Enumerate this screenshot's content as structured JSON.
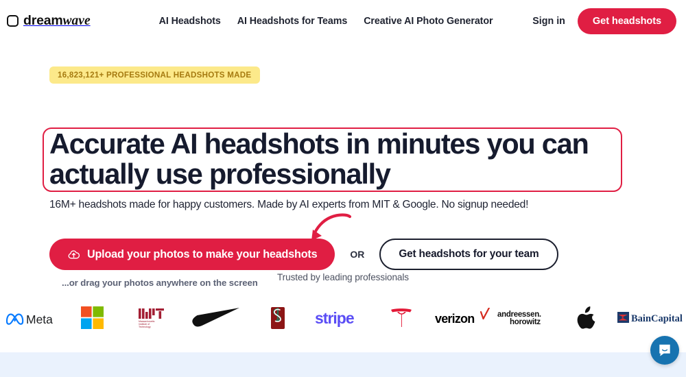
{
  "brand": {
    "name_bold": "dream",
    "name_italic": "wave",
    "mark_icon": "rounded-square-outline-icon"
  },
  "nav": {
    "links": [
      {
        "label": "AI Headshots"
      },
      {
        "label": "AI Headshots for Teams"
      },
      {
        "label": "Creative AI Photo Generator"
      }
    ],
    "sign_in": "Sign in",
    "cta": "Get headshots"
  },
  "hero": {
    "badge": "16,823,121+ PROFESSIONAL HEADSHOTS MADE",
    "headline": "Accurate AI headshots in minutes you can actually use professionally",
    "subhead": "16M+ headshots made for happy customers. Made by AI experts from MIT & Google. No signup needed!",
    "upload_button": "Upload your photos to make your headshots",
    "upload_icon": "cloud-upload-icon",
    "or": "OR",
    "team_button": "Get headshots for your team",
    "drag_note": "...or drag your photos anywhere on the screen",
    "arrow_icon": "curved-arrow-icon"
  },
  "trusted": {
    "heading": "Trusted by leading professionals",
    "logos": [
      {
        "name": "Meta",
        "icon": "meta-logo"
      },
      {
        "name": "Microsoft",
        "icon": "microsoft-logo"
      },
      {
        "name": "MIT",
        "icon": "mit-logo",
        "sub": "Massachusetts Institute of Technology"
      },
      {
        "name": "Nike",
        "icon": "nike-swoosh-logo"
      },
      {
        "name": "Stanford",
        "icon": "stanford-logo"
      },
      {
        "name": "stripe",
        "icon": "stripe-logo"
      },
      {
        "name": "Tesla",
        "icon": "tesla-logo"
      },
      {
        "name": "verizon",
        "icon": "verizon-logo"
      },
      {
        "name": "andreessen horowitz",
        "icon": "a16z-logo",
        "line1": "andreessen",
        "line2": "horowitz"
      },
      {
        "name": "Apple",
        "icon": "apple-logo"
      },
      {
        "name": "BainCapital",
        "icon": "bain-capital-logo"
      }
    ]
  },
  "chat": {
    "icon": "chat-bubble-icon",
    "color": "#1773b0"
  },
  "colors": {
    "accent_red": "#e01e43",
    "badge_bg": "#fce98a",
    "badge_text": "#a67a10",
    "headline": "#161b2e",
    "bottom_band": "#eaf2fd"
  }
}
